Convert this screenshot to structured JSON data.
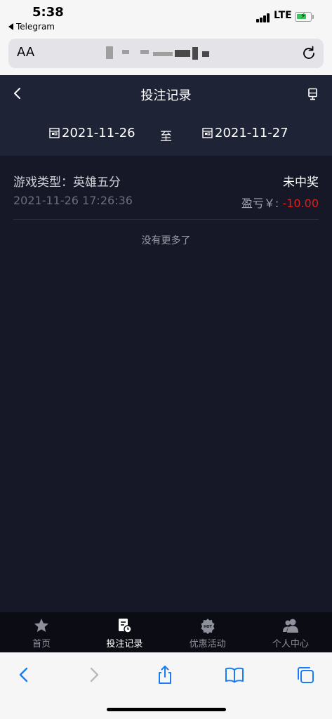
{
  "status_bar": {
    "time": "5:38",
    "back_app": "Telegram",
    "network": "LTE"
  },
  "browser": {
    "text_size_button": "AA"
  },
  "header": {
    "title": "投注记录",
    "back_icon": "chevron-left-icon",
    "right_icon": "cup-icon"
  },
  "date_filter": {
    "start": "2021-11-26",
    "separator": "至",
    "end": "2021-11-27"
  },
  "records": [
    {
      "game_type": "游戏类型：英雄五分",
      "result": "未中奖",
      "time": "2021-11-26 17:26:36",
      "profit_label": "盈亏￥:",
      "profit_value": "-10.00"
    }
  ],
  "no_more_text": "没有更多了",
  "tab_bar": [
    {
      "label": "首页",
      "icon": "star-icon",
      "active": false
    },
    {
      "label": "投注记录",
      "icon": "record-icon",
      "active": true
    },
    {
      "label": "优惠活动",
      "icon": "hot-badge-icon",
      "active": false
    },
    {
      "label": "个人中心",
      "icon": "people-icon",
      "active": false
    }
  ],
  "colors": {
    "header_bg": "#1e2335",
    "content_bg": "#161827",
    "tab_bar_bg": "#0c0d14",
    "loss_red": "#e11e1e",
    "ios_blue": "#1a7cf5"
  }
}
